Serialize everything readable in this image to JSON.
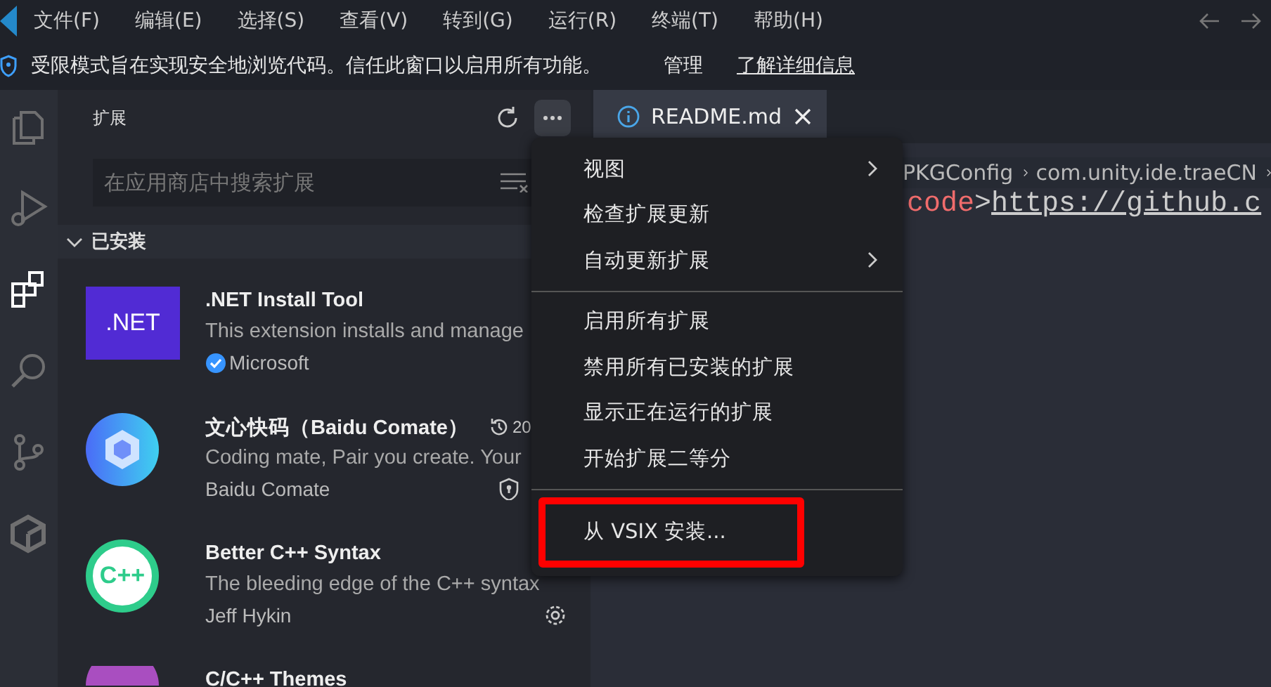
{
  "menubar": {
    "items": [
      "文件(F)",
      "编辑(E)",
      "选择(S)",
      "查看(V)",
      "转到(G)",
      "运行(R)",
      "终端(T)",
      "帮助(H)"
    ]
  },
  "banner": {
    "message": "受限模式旨在实现安全地浏览代码。信任此窗口以启用所有功能。",
    "actions": [
      {
        "label": "管理",
        "kind": "button"
      },
      {
        "label": "了解详细信息",
        "kind": "link"
      }
    ]
  },
  "activity_bar": [
    {
      "kind": "files",
      "selected": false
    },
    {
      "kind": "run",
      "selected": false
    },
    {
      "kind": "extensions",
      "selected": true
    },
    {
      "kind": "search",
      "selected": false
    },
    {
      "kind": "source-control",
      "selected": false
    },
    {
      "kind": "cube",
      "selected": false
    }
  ],
  "sidebar": {
    "title": "扩展",
    "more_button": {
      "active": true
    },
    "search": {
      "placeholder": "在应用商店中搜索扩展"
    },
    "section": {
      "title": "已安装",
      "expanded": true
    },
    "extensions": [
      {
        "logo": {
          "kind": "square",
          "text": ".NET"
        },
        "name": ".NET Install Tool",
        "description": "This extension installs and manage",
        "publisher": "Microsoft",
        "verified": true
      },
      {
        "logo": {
          "kind": "cube"
        },
        "name": "文心快码（Baidu Comate）",
        "recent": "20",
        "description": "Coding mate, Pair you create. Your",
        "publisher": "Baidu Comate",
        "action": {
          "kind": "shield"
        }
      },
      {
        "logo": {
          "kind": "ring",
          "text": "C++"
        },
        "name": "Better C++ Syntax",
        "description": "The bleeding edge of the C++ syntax",
        "publisher": "Jeff Hykin",
        "action": {
          "kind": "gear"
        }
      },
      {
        "logo": {
          "kind": "circle"
        },
        "name": "C/C++ Themes"
      }
    ]
  },
  "editor": {
    "tab": {
      "label": "README.md",
      "selected": true
    },
    "breadcrumb": [
      "PKGConfig",
      "com.unity.ide.traeCN"
    ],
    "code": [
      {
        "text": "code",
        "kind": "tag"
      },
      {
        "text": ">",
        "kind": "punct"
      },
      {
        "text": "https://github.c",
        "kind": "link"
      }
    ]
  },
  "context_menu": {
    "items": [
      {
        "kind": "item",
        "label": "视图",
        "submenu": true,
        "highlighted": false
      },
      {
        "kind": "item",
        "label": "检查扩展更新",
        "submenu": false,
        "highlighted": false
      },
      {
        "kind": "item",
        "label": "自动更新扩展",
        "submenu": true,
        "highlighted": false
      },
      {
        "kind": "separator"
      },
      {
        "kind": "item",
        "label": "启用所有扩展",
        "submenu": false,
        "highlighted": false
      },
      {
        "kind": "item",
        "label": "禁用所有已安装的扩展",
        "submenu": false,
        "highlighted": false
      },
      {
        "kind": "item",
        "label": "显示正在运行的扩展",
        "submenu": false,
        "highlighted": false
      },
      {
        "kind": "item",
        "label": "开始扩展二等分",
        "submenu": false,
        "highlighted": false
      },
      {
        "kind": "separator"
      },
      {
        "kind": "item",
        "label": "从 VSIX 安装...",
        "submenu": false,
        "highlighted": true
      }
    ]
  }
}
